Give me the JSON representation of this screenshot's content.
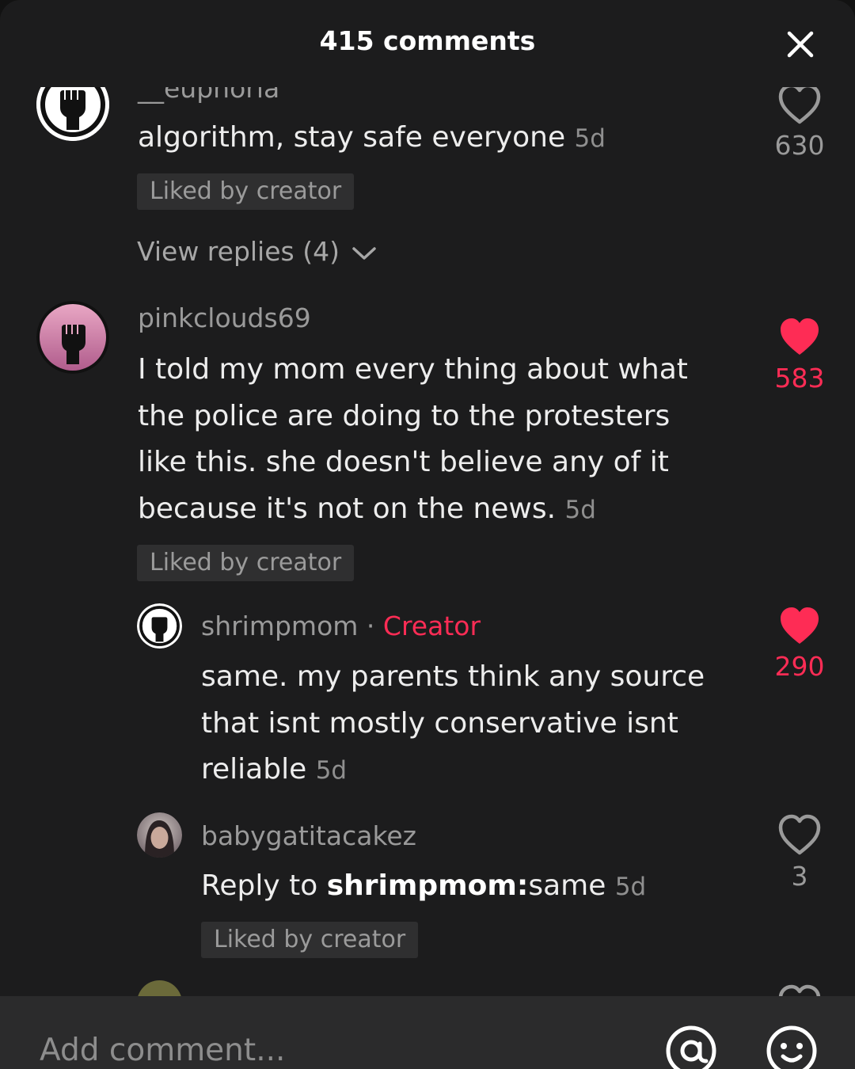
{
  "header": {
    "title": "415 comments",
    "close_icon": "close-icon"
  },
  "comments": [
    {
      "username": "__euphoria",
      "text": "algorithm, stay safe everyone",
      "time": "5d",
      "liked_by_creator": "Liked by creator",
      "like_count": "630",
      "liked": false,
      "view_replies": "View replies (4)"
    },
    {
      "username": "pinkclouds69",
      "text": "I told my mom every thing about what the police are doing to the protesters like this. she doesn't believe any of it because it's not on the news.",
      "time": "5d",
      "liked_by_creator": "Liked by creator",
      "like_count": "583",
      "liked": true
    }
  ],
  "replies": [
    {
      "username": "shrimpmom",
      "separator": "·",
      "creator_label": "Creator",
      "text": "same. my parents think any source that isnt mostly conservative isnt reliable",
      "time": "5d",
      "like_count": "290",
      "liked": true
    },
    {
      "username": "babygatitacakez",
      "reply_prefix": "Reply to ",
      "reply_target": "shrimpmom:",
      "text": "same",
      "time": "5d",
      "liked_by_creator": "Liked by creator",
      "like_count": "3",
      "liked": false
    }
  ],
  "bottom_bar": {
    "placeholder": "Add comment...",
    "mention_icon": "at-sign-icon",
    "emoji_icon": "emoji-icon"
  },
  "colors": {
    "background": "#1c1c1d",
    "liked_red": "#fe2c55",
    "muted_text": "#9a9a9a"
  }
}
